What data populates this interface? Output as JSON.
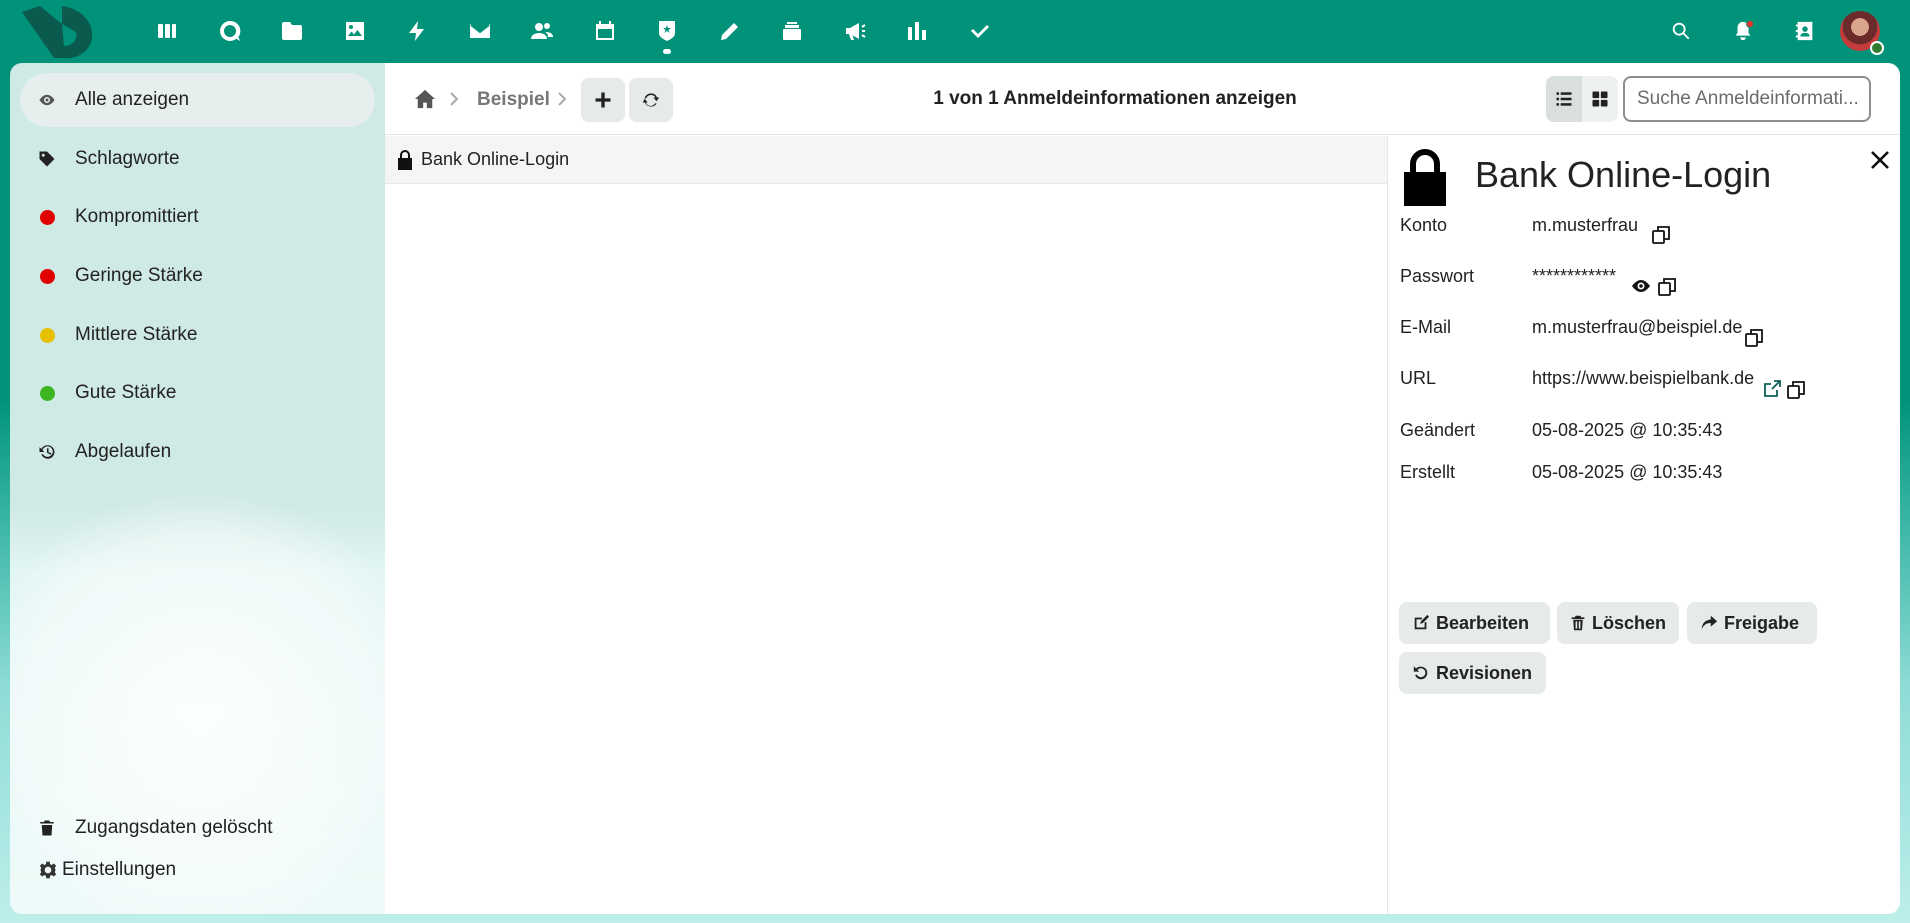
{
  "topbar": {
    "apps": [
      {
        "name": "dashboard-icon"
      },
      {
        "name": "talk-icon"
      },
      {
        "name": "files-icon"
      },
      {
        "name": "photos-icon"
      },
      {
        "name": "activity-icon"
      },
      {
        "name": "mail-icon"
      },
      {
        "name": "contacts-icon"
      },
      {
        "name": "calendar-icon"
      },
      {
        "name": "passwords-icon",
        "active": true
      },
      {
        "name": "notes-icon"
      },
      {
        "name": "deck-icon"
      },
      {
        "name": "announcements-icon"
      },
      {
        "name": "analytics-icon"
      },
      {
        "name": "tasks-icon"
      }
    ],
    "right": [
      "search-icon",
      "notifications-icon",
      "contacts-menu-icon",
      "user-avatar"
    ]
  },
  "sidebar": {
    "items": [
      {
        "label": "Alle anzeigen",
        "icon": "eye-icon",
        "active": true
      },
      {
        "label": "Schlagworte",
        "icon": "tag-icon"
      },
      {
        "label": "Kompromittiert",
        "dot_color": "#e00000"
      },
      {
        "label": "Geringe Stärke",
        "dot_color": "#e00000"
      },
      {
        "label": "Mittlere Stärke",
        "dot_color": "#e6c000"
      },
      {
        "label": "Gute Stärke",
        "dot_color": "#3cb521"
      },
      {
        "label": "Abgelaufen",
        "icon": "history-icon"
      }
    ],
    "deleted_label": "Zugangsdaten gelöscht",
    "settings_label": "Einstellungen"
  },
  "toolbar": {
    "breadcrumb": "Beispiel",
    "count_title": "1 von 1 Anmeldeinformationen anzeigen",
    "search_placeholder": "Suche Anmeldeinformati..."
  },
  "list": {
    "rows": [
      {
        "label": "Bank Online-Login"
      }
    ]
  },
  "detail": {
    "title": "Bank Online-Login",
    "fields": {
      "konto": {
        "label": "Konto",
        "value": "m.musterfrau"
      },
      "passwort": {
        "label": "Passwort",
        "value": "************"
      },
      "email": {
        "label": "E-Mail",
        "value": "m.musterfrau@beispiel.de"
      },
      "url": {
        "label": "URL",
        "value": "https://www.beispielbank.de"
      },
      "geaendert": {
        "label": "Geändert",
        "value": "05-08-2025 @ 10:35:43"
      },
      "erstellt": {
        "label": "Erstellt",
        "value": "05-08-2025 @ 10:35:43"
      }
    },
    "actions": {
      "edit": "Bearbeiten",
      "delete": "Löschen",
      "share": "Freigabe",
      "revisions": "Revisionen"
    }
  },
  "colors": {
    "header_bg": "#00937a",
    "sidebar_bg": "#cfe9e4"
  }
}
